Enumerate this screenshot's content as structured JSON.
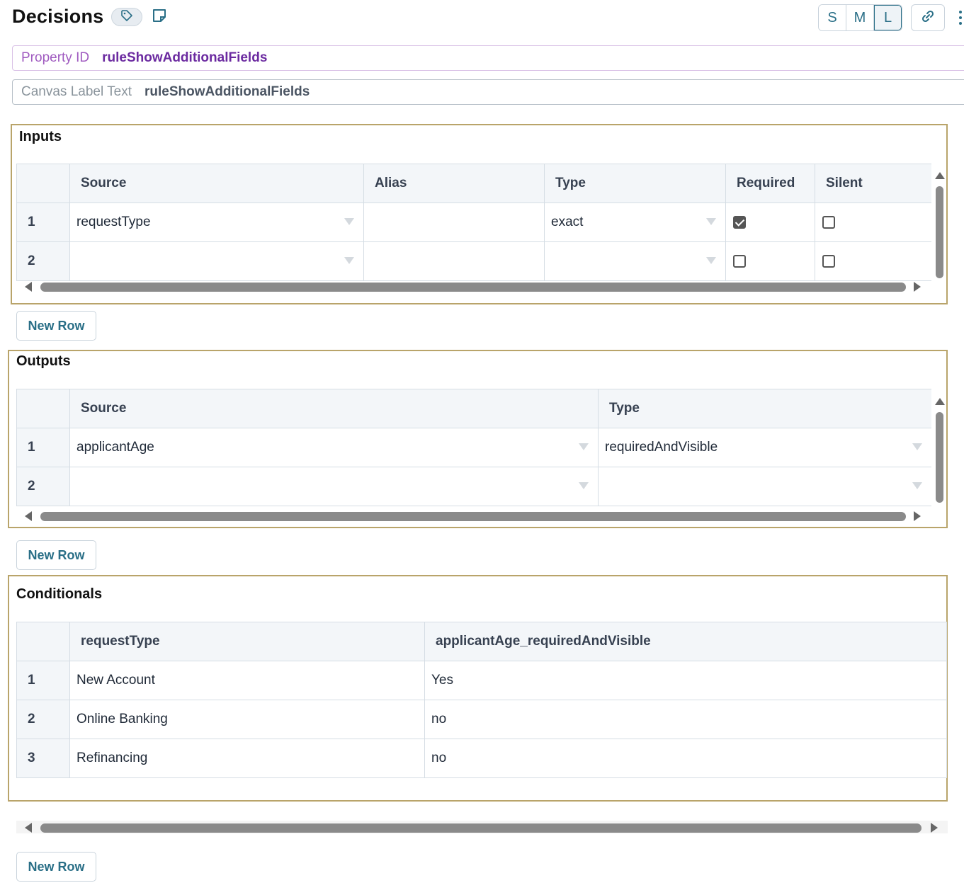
{
  "header": {
    "title": "Decisions",
    "size_buttons": [
      "S",
      "M",
      "L"
    ],
    "selected_size": "L"
  },
  "property_id": {
    "label": "Property ID",
    "value": "ruleShowAdditionalFields"
  },
  "canvas_label": {
    "label": "Canvas Label Text",
    "value": "ruleShowAdditionalFields"
  },
  "inputs": {
    "title": "Inputs",
    "columns": [
      "Source",
      "Alias",
      "Type",
      "Required",
      "Silent"
    ],
    "rows": [
      {
        "index": "1",
        "source": "requestType",
        "alias": "",
        "type": "exact",
        "required": true,
        "silent": false
      },
      {
        "index": "2",
        "source": "",
        "alias": "",
        "type": "",
        "required": false,
        "silent": false
      }
    ],
    "new_row_label": "New Row"
  },
  "outputs": {
    "title": "Outputs",
    "columns": [
      "Source",
      "Type"
    ],
    "rows": [
      {
        "index": "1",
        "source": "applicantAge",
        "type": "requiredAndVisible"
      },
      {
        "index": "2",
        "source": "",
        "type": ""
      }
    ],
    "new_row_label": "New Row"
  },
  "conditionals": {
    "title": "Conditionals",
    "columns": [
      "requestType",
      "applicantAge_requiredAndVisible"
    ],
    "rows": [
      {
        "index": "1",
        "request_type": "New Account",
        "value": "Yes"
      },
      {
        "index": "2",
        "request_type": "Online Banking",
        "value": "no"
      },
      {
        "index": "3",
        "request_type": "Refinancing",
        "value": "no"
      }
    ],
    "new_row_label": "New Row"
  },
  "colors": {
    "accent": "#2a6f87",
    "panel_border": "#b9a46a",
    "property_id": "#6b2aa0"
  }
}
